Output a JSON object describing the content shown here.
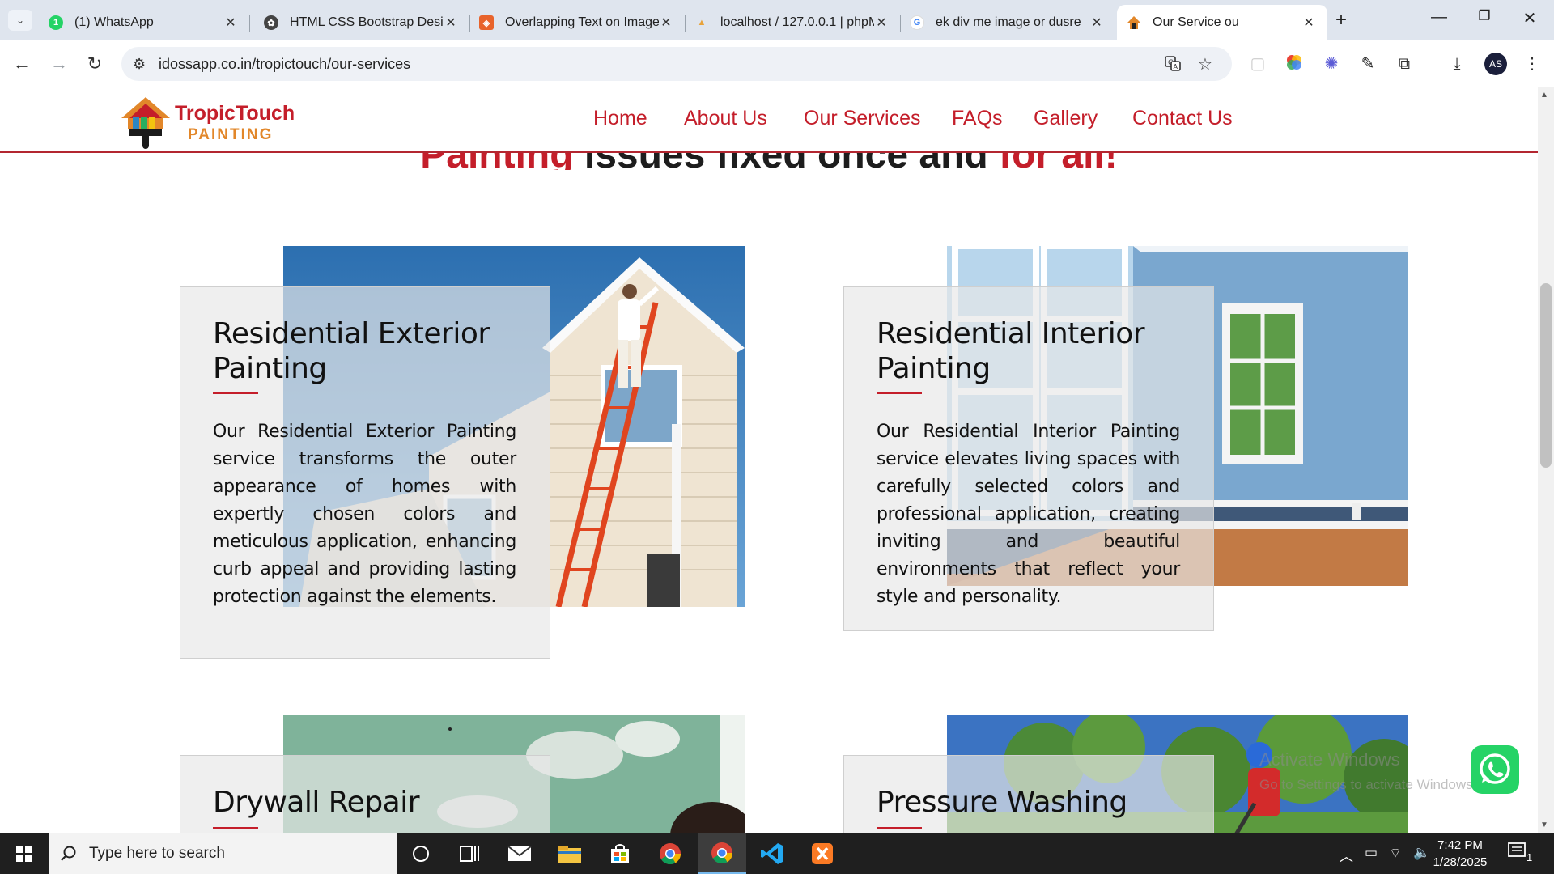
{
  "browser": {
    "tabs": [
      {
        "title": "(1) WhatsApp",
        "icon": "whatsapp-icon",
        "badge": "1"
      },
      {
        "title": "HTML CSS Bootstrap Desig",
        "icon": "openai-icon"
      },
      {
        "title": "Overlapping Text on Image",
        "icon": "codepen-icon"
      },
      {
        "title": "localhost / 127.0.0.1 | phpM",
        "icon": "phpmyadmin-icon"
      },
      {
        "title": "ek div me image or dusre",
        "icon": "google-icon"
      },
      {
        "title": "Our Service ou",
        "icon": "tropictouch-icon",
        "active": true
      }
    ],
    "url": "idossapp.co.in/tropictouch/our-services",
    "profile_initials": "AS"
  },
  "site": {
    "brand_line1": "TropicTouch",
    "brand_line2": "PAINTING",
    "nav": [
      "Home",
      "About Us",
      "Our Services",
      "FAQs",
      "Gallery",
      "Contact Us"
    ],
    "heading": {
      "part1": "Painting",
      "part2": " issues fixed once and ",
      "part3": "for all!"
    },
    "services": [
      {
        "title": "Residential Exterior Painting",
        "description": "Our Residential Exterior Painting service transforms the outer appearance of homes with expertly chosen colors and meticulous application, enhancing curb appeal and providing lasting protection against the elements."
      },
      {
        "title": "Residential Interior Painting",
        "description": "Our Residential Interior Painting service elevates living spaces with carefully selected colors and professional application, creating inviting and beautiful environments that reflect your style and personality."
      },
      {
        "title": "Drywall Repair",
        "description": ""
      },
      {
        "title": "Pressure Washing",
        "description": ""
      }
    ],
    "watermark_line1": "Activate Windows",
    "watermark_line2": "Go to Settings to activate Windows."
  },
  "taskbar": {
    "search_placeholder": "Type here to search",
    "time": "7:42 PM",
    "date": "1/28/2025",
    "notification_count": "1"
  },
  "colors": {
    "brand_red": "#c41e2a",
    "brand_orange": "#e2872a",
    "whatsapp_green": "#25d366"
  }
}
